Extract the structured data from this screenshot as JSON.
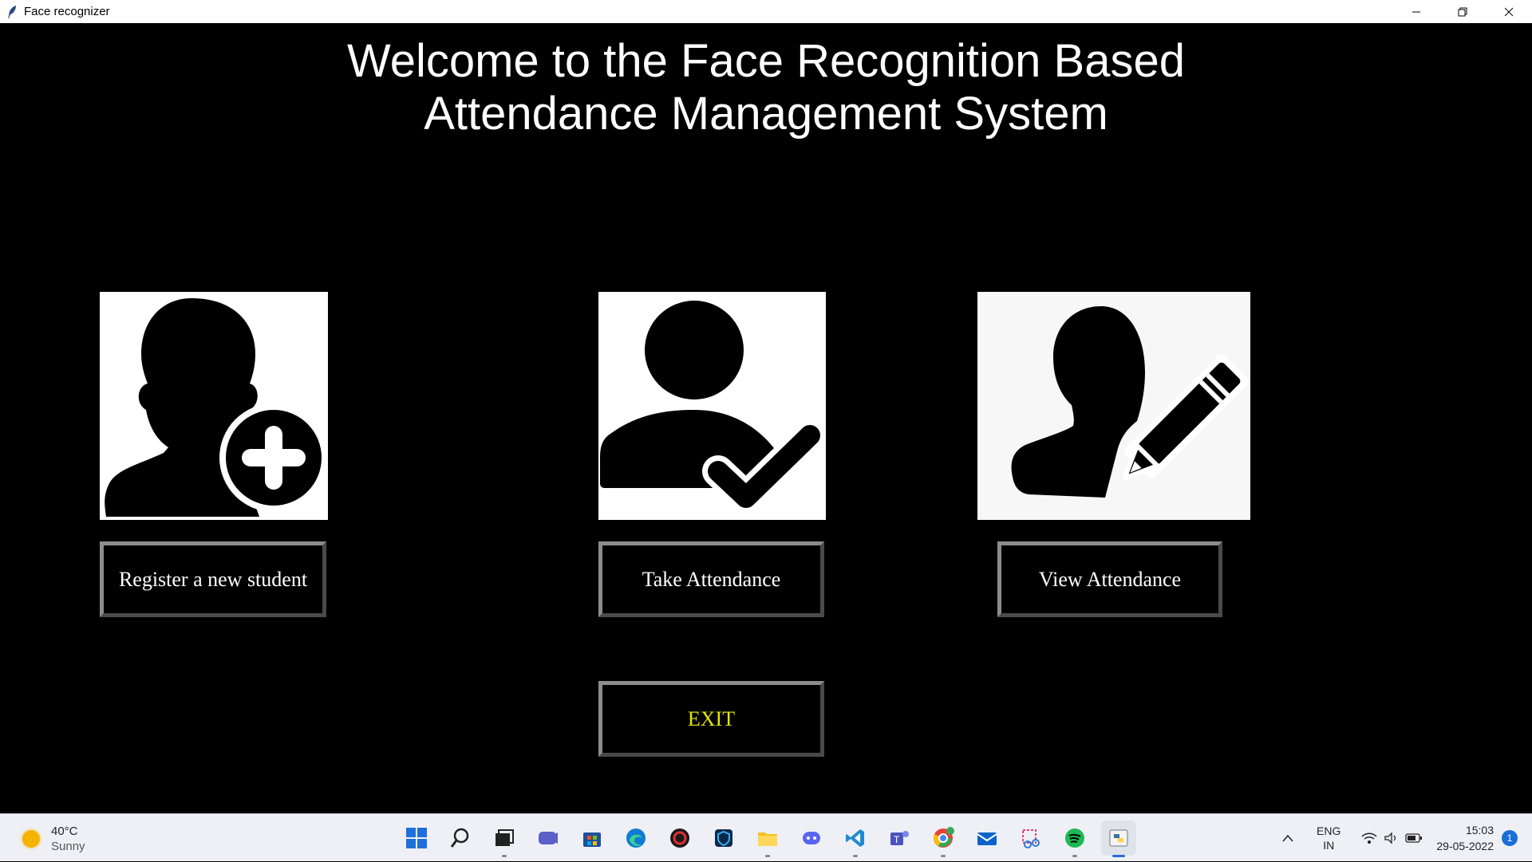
{
  "window": {
    "title": "Face recognizer",
    "controls": {
      "minimize": "—",
      "restore": "❐",
      "close": "✕"
    }
  },
  "main": {
    "heading_line1": "Welcome to the Face Recognition Based",
    "heading_line2": "Attendance Management System",
    "cards": [
      {
        "icon": "user-add-icon"
      },
      {
        "icon": "user-check-icon"
      },
      {
        "icon": "user-edit-icon"
      }
    ],
    "buttons": {
      "register": "Register a new student",
      "take": "Take Attendance",
      "view": "View Attendance",
      "exit": "EXIT"
    },
    "colors": {
      "background": "#000000",
      "button_text": "#ffffff",
      "exit_text": "#e6e600"
    }
  },
  "taskbar": {
    "weather": {
      "temp": "40°C",
      "condition": "Sunny"
    },
    "apps": [
      "start",
      "search",
      "task-view",
      "chat",
      "store",
      "edge",
      "app",
      "defender",
      "file-explorer",
      "discord",
      "vscode",
      "teams",
      "chrome",
      "mail",
      "snipping-tool",
      "spotify",
      "python"
    ],
    "tray": {
      "lang_line1": "ENG",
      "lang_line2": "IN",
      "time": "15:03",
      "date": "29-05-2022",
      "notifications": "1"
    }
  }
}
